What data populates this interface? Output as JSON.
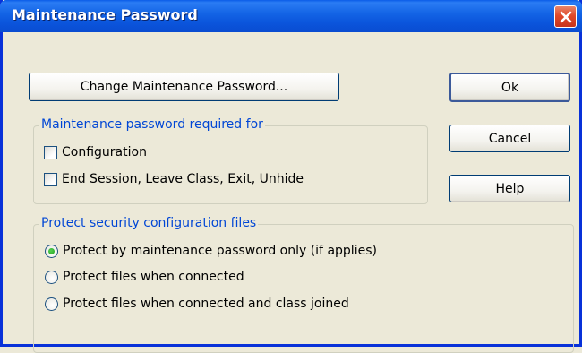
{
  "window": {
    "title": "Maintenance Password"
  },
  "buttons": {
    "change_password": "Change Maintenance Password...",
    "ok": "Ok",
    "cancel": "Cancel",
    "help": "Help"
  },
  "required_group": {
    "label": "Maintenance password required for",
    "options": [
      {
        "label": "Configuration",
        "checked": false
      },
      {
        "label": "End Session, Leave Class, Exit, Unhide",
        "checked": false
      }
    ]
  },
  "protect_group": {
    "label": "Protect security configuration files",
    "options": [
      {
        "label": "Protect by maintenance password only (if applies)",
        "selected": true
      },
      {
        "label": "Protect files when connected",
        "selected": false
      },
      {
        "label": "Protect files when connected and class joined",
        "selected": false
      }
    ]
  },
  "icons": {
    "close": "close-icon"
  },
  "colors": {
    "title_bar": "#0a5ce8",
    "group_label": "#0046d5",
    "close_button": "#e0492a"
  }
}
